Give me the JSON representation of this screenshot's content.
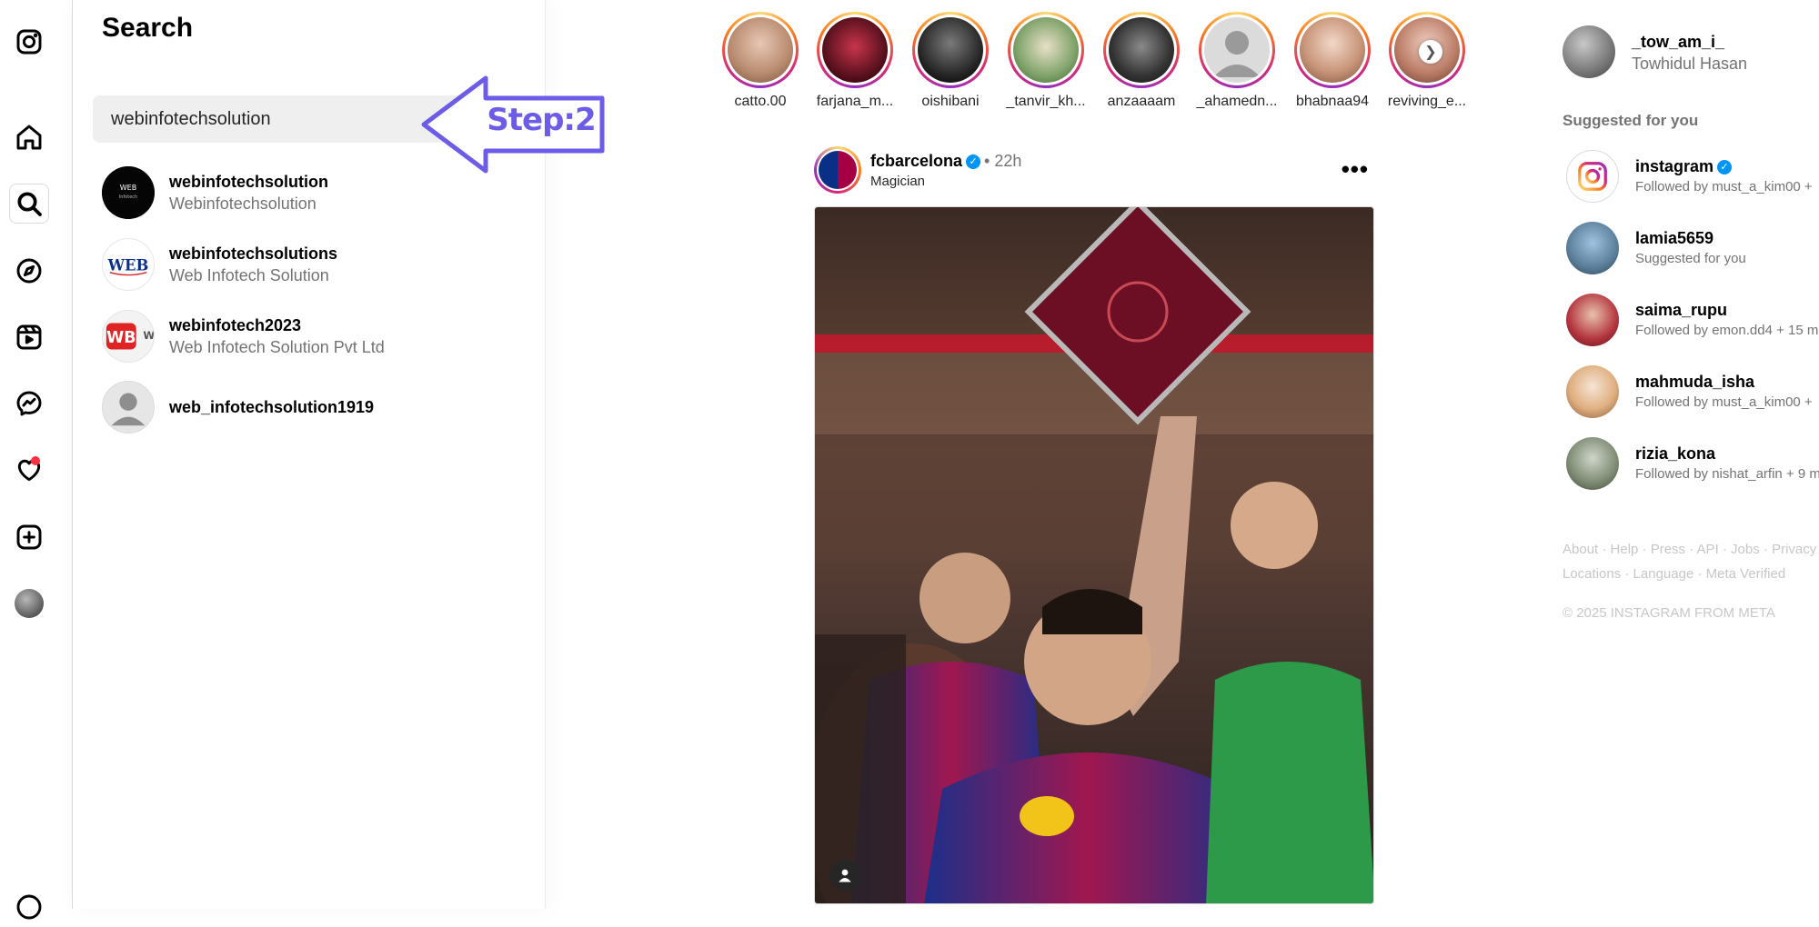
{
  "app": {
    "name": "Instagram"
  },
  "rail": {
    "items": [
      {
        "icon": "instagram-logo-icon"
      },
      {
        "icon": "home-icon"
      },
      {
        "icon": "search-icon"
      },
      {
        "icon": "explore-compass-icon"
      },
      {
        "icon": "reels-icon"
      },
      {
        "icon": "messenger-icon"
      },
      {
        "icon": "heart-notifications-icon"
      },
      {
        "icon": "create-plus-icon"
      },
      {
        "icon": "profile-avatar"
      }
    ]
  },
  "search": {
    "title": "Search",
    "query": "webinfotechsolution",
    "results": [
      {
        "username": "webinfotechsolution",
        "fullname": "Webinfotechsolution"
      },
      {
        "username": "webinfotechsolutions",
        "fullname": "Web Infotech Solution"
      },
      {
        "username": "webinfotech2023",
        "fullname": "Web Infotech Solution Pvt Ltd"
      },
      {
        "username": "web_infotechsolution1919",
        "fullname": ""
      }
    ]
  },
  "annotation": {
    "label": "Step:2",
    "color": "#6c5ce7"
  },
  "stories": [
    {
      "label": "catto.00"
    },
    {
      "label": "farjana_m..."
    },
    {
      "label": "oishibani"
    },
    {
      "label": "_tanvir_kh..."
    },
    {
      "label": "anzaaaam"
    },
    {
      "label": "_ahamedn..."
    },
    {
      "label": "bhabnaa94"
    },
    {
      "label": "reviving_e..."
    }
  ],
  "post": {
    "username": "fcbarcelona",
    "time": "22h",
    "location": "Magician",
    "more": "•••"
  },
  "me": {
    "username": "_tow_am_i_",
    "fullname": "Towhidul Hasan"
  },
  "suggested": {
    "title": "Suggested for you",
    "items": [
      {
        "username": "instagram",
        "sub": "Followed by must_a_kim00 +",
        "verified": true
      },
      {
        "username": "lamia5659",
        "sub": "Suggested for you"
      },
      {
        "username": "saima_rupu",
        "sub": "Followed by emon.dd4 + 15 m"
      },
      {
        "username": "mahmuda_isha",
        "sub": "Followed by must_a_kim00 +"
      },
      {
        "username": "rizia_kona",
        "sub": "Followed by nishat_arfin + 9 m"
      }
    ]
  },
  "footer": {
    "line1": "About · Help · Press · API · Jobs · Privacy",
    "line2": "Locations · Language · Meta Verified",
    "copyright": "© 2025 INSTAGRAM FROM META"
  },
  "colors": {
    "verified": "#0095f6",
    "notification": "#ff3040",
    "muted": "#737373"
  }
}
